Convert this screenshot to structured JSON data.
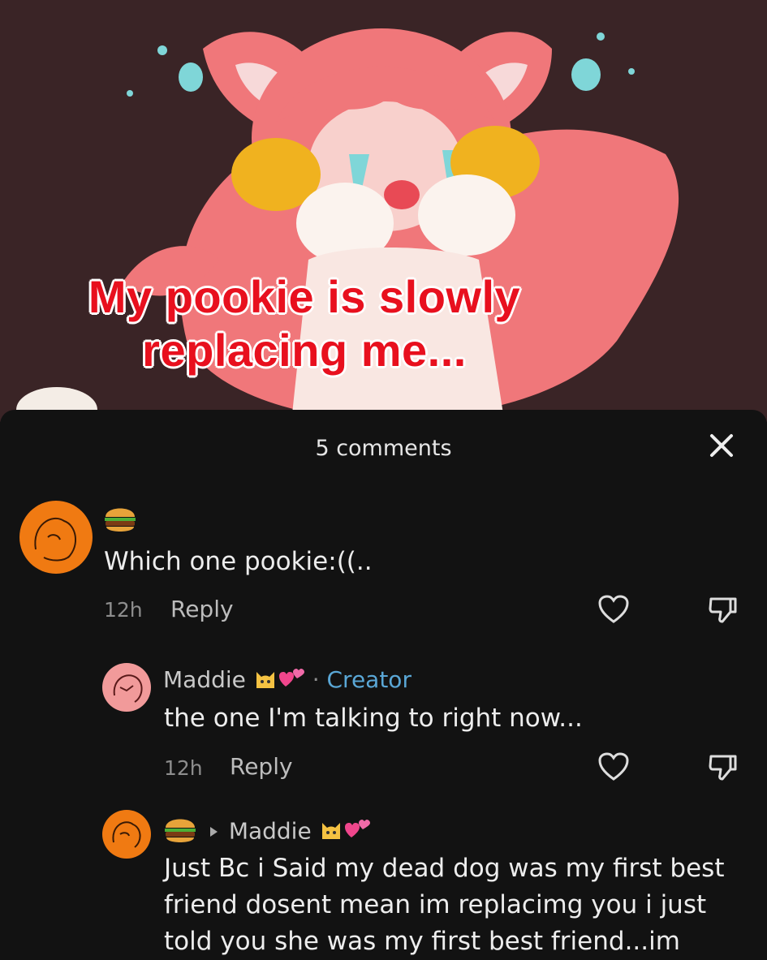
{
  "post": {
    "caption_line1": "My pookie is slowly",
    "caption_line2": "replacing me..."
  },
  "comments_panel": {
    "title": "5 comments",
    "close_icon": "close-icon"
  },
  "comments": [
    {
      "author_icon": "hamburger-emoji",
      "text": "Which one pookie:((..",
      "time": "12h",
      "reply_label": "Reply"
    },
    {
      "author": "Maddie",
      "author_badges": [
        "cat-face-emoji",
        "two-hearts-emoji"
      ],
      "separator": "·",
      "role": "Creator",
      "text": "the one I'm talking to right now...",
      "time": "12h",
      "reply_label": "Reply"
    },
    {
      "author_icon": "hamburger-emoji",
      "reply_to": "Maddie",
      "text_lines": [
        "Just Bc i Said my dead dog was my first best",
        "friend dosent mean im replacimg you i just",
        "told you she was my first best friend...im"
      ]
    }
  ],
  "colors": {
    "hero_bg": "#3a2426",
    "panel_bg": "#121212",
    "caption_red": "#e8101e",
    "creator_blue": "#5aa7d6",
    "avatar_orange": "#f07a12",
    "avatar_pink": "#f19a9a"
  }
}
